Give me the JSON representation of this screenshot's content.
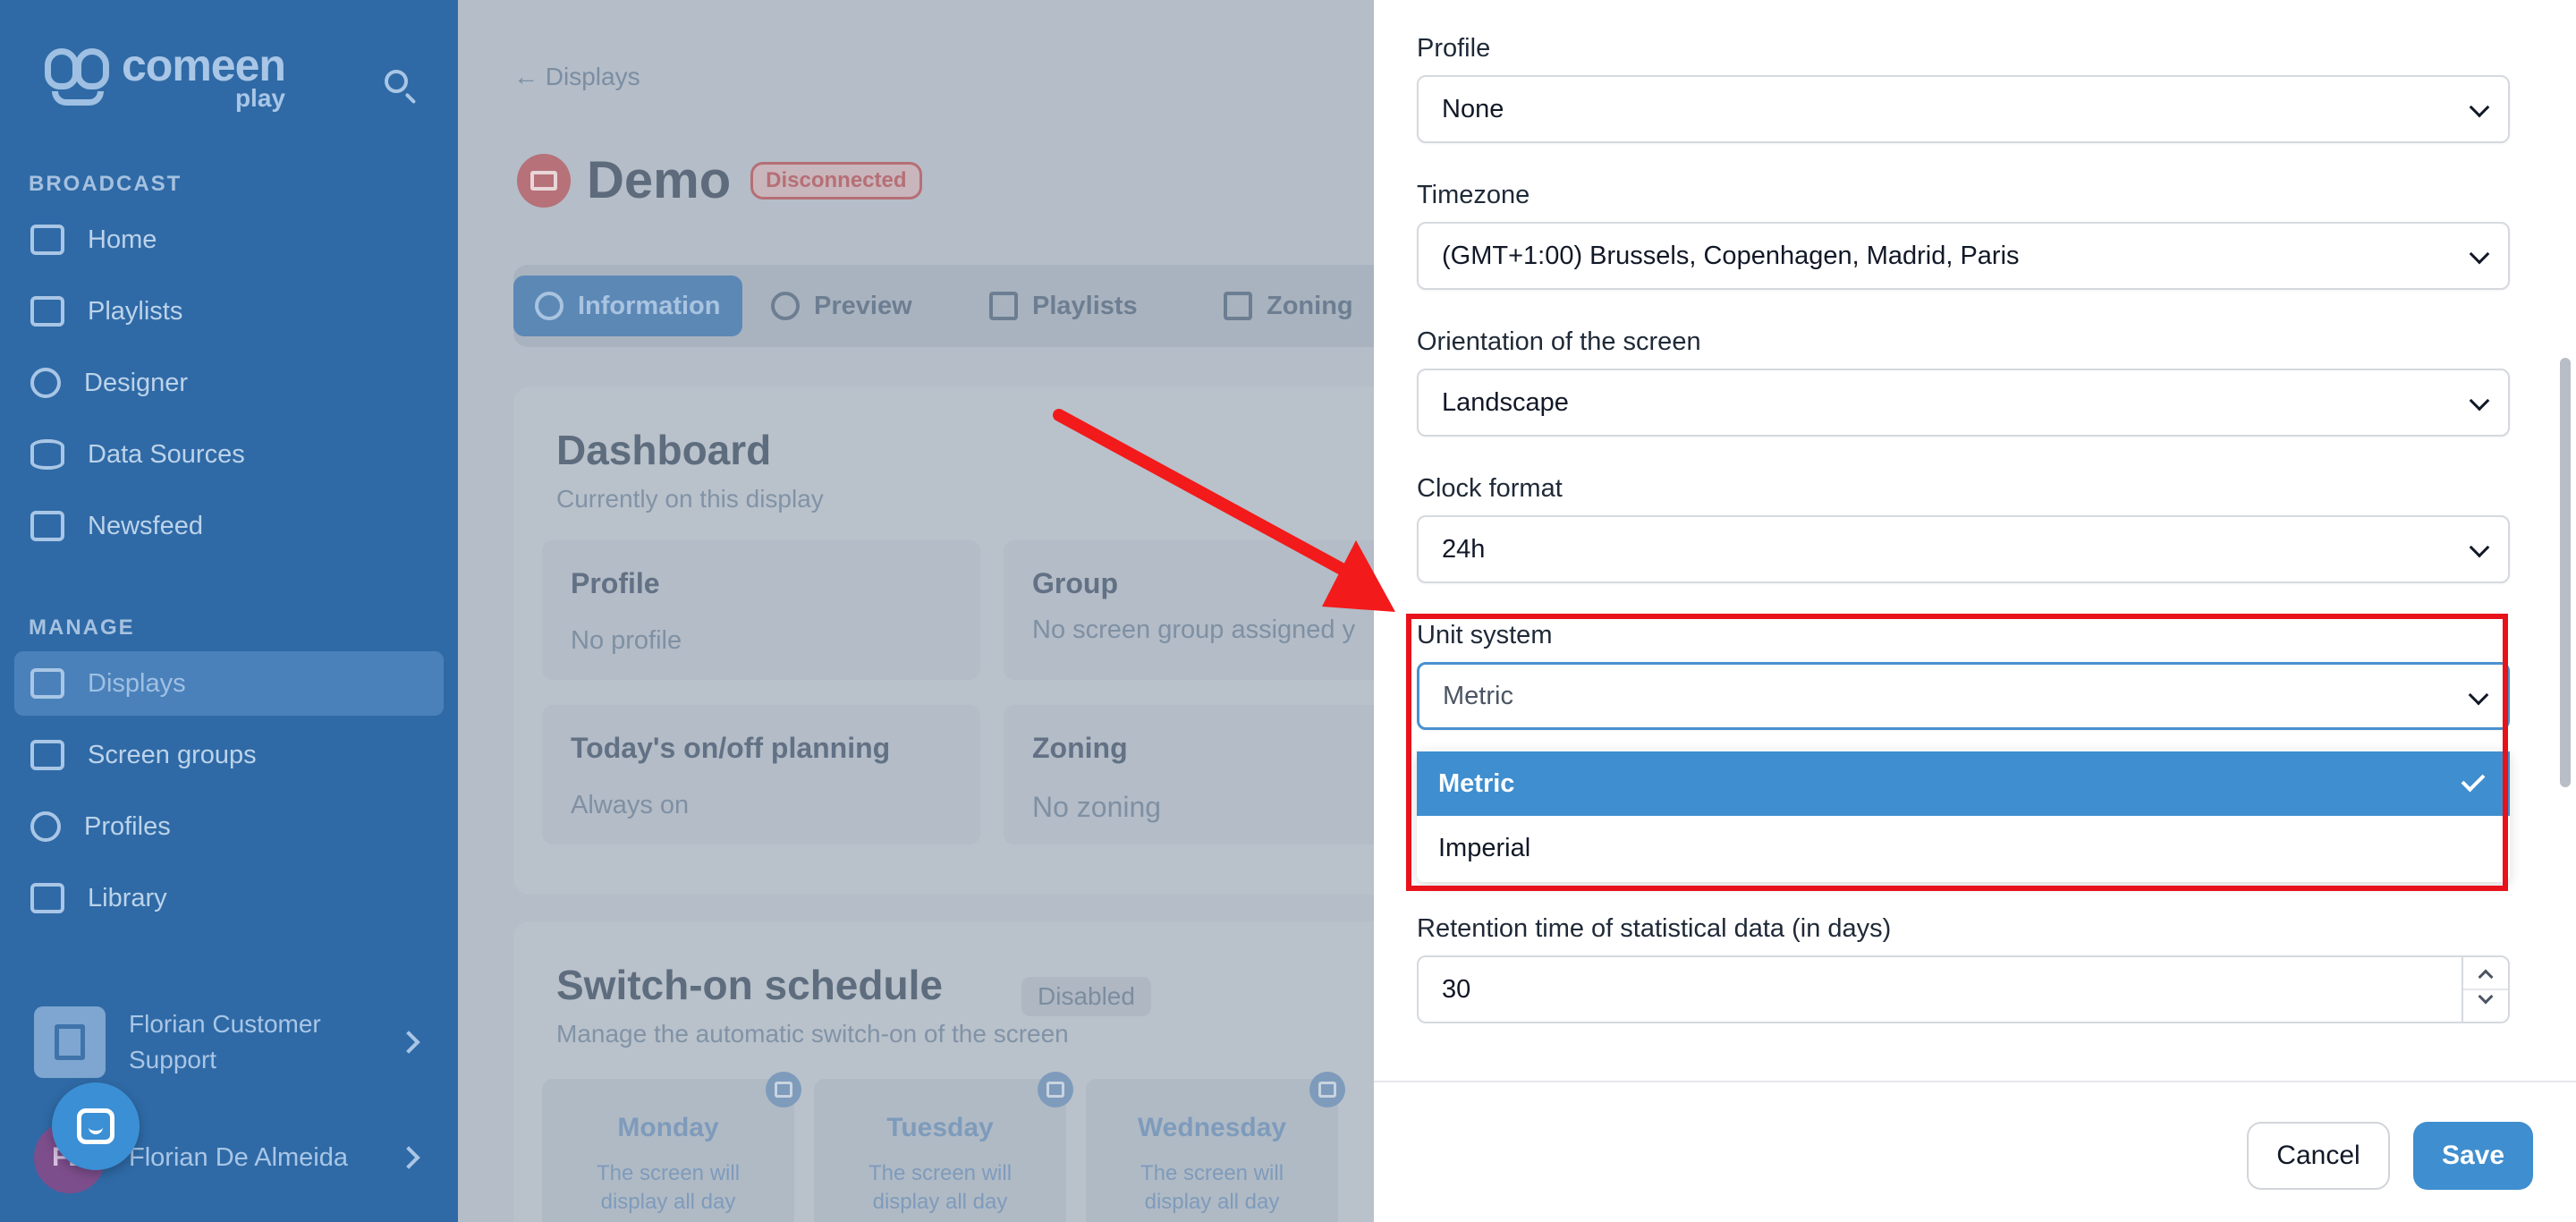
{
  "sidebar": {
    "logo": {
      "name": "comeen",
      "sub": "play"
    },
    "sections": [
      {
        "label": "BROADCAST",
        "items": [
          {
            "label": "Home",
            "icon": "home-icon"
          },
          {
            "label": "Playlists",
            "icon": "playlist-icon"
          },
          {
            "label": "Designer",
            "icon": "designer-icon"
          },
          {
            "label": "Data Sources",
            "icon": "database-icon"
          },
          {
            "label": "Newsfeed",
            "icon": "newsfeed-icon"
          }
        ]
      },
      {
        "label": "MANAGE",
        "items": [
          {
            "label": "Displays",
            "icon": "display-icon",
            "active": true
          },
          {
            "label": "Screen groups",
            "icon": "folder-icon"
          },
          {
            "label": "Profiles",
            "icon": "gear-icon"
          },
          {
            "label": "Library",
            "icon": "image-library-icon"
          }
        ]
      }
    ],
    "organization": "Florian Customer Support",
    "user": {
      "name": "Florian De Almeida",
      "initials": "FD"
    }
  },
  "main": {
    "back_link": "← Displays",
    "title": "Demo",
    "status_badge": "Disconnected",
    "tabs": [
      {
        "label": "Information",
        "active": true
      },
      {
        "label": "Preview"
      },
      {
        "label": "Playlists"
      },
      {
        "label": "Zoning"
      }
    ],
    "dashboard": {
      "title": "Dashboard",
      "subtitle": "Currently on this display",
      "tiles": [
        {
          "title": "Profile",
          "value": "No profile"
        },
        {
          "title": "Group",
          "value": "No screen group assigned y"
        },
        {
          "title": "Today's on/off planning",
          "value": "Always on"
        },
        {
          "title": "Zoning",
          "value": "No zoning"
        }
      ]
    },
    "schedule": {
      "title": "Switch-on schedule",
      "badge": "Disabled",
      "subtitle": "Manage the automatic switch-on of the screen",
      "days": [
        {
          "name": "Monday",
          "line1": "The screen will",
          "line2": "display all day"
        },
        {
          "name": "Tuesday",
          "line1": "The screen will",
          "line2": "display all day"
        },
        {
          "name": "Wednesday",
          "line1": "The screen will",
          "line2": "display all day"
        }
      ]
    }
  },
  "drawer": {
    "fields": [
      {
        "label": "Profile",
        "value": "None"
      },
      {
        "label": "Timezone",
        "value": "(GMT+1:00) Brussels, Copenhagen, Madrid, Paris"
      },
      {
        "label": "Orientation of the screen",
        "value": "Landscape"
      },
      {
        "label": "Clock format",
        "value": "24h"
      },
      {
        "label": "Unit system",
        "value": "Metric"
      }
    ],
    "unit_options": [
      "Metric",
      "Imperial"
    ],
    "selected_unit": "Metric",
    "retention": {
      "label": "Retention time of statistical data (in days)",
      "value": "30"
    },
    "cancel_label": "Cancel",
    "save_label": "Save"
  },
  "colors": {
    "accent": "#3f8ecf",
    "annotation_red": "#e8121b",
    "sidebar_bg": "#2f6aa6"
  }
}
